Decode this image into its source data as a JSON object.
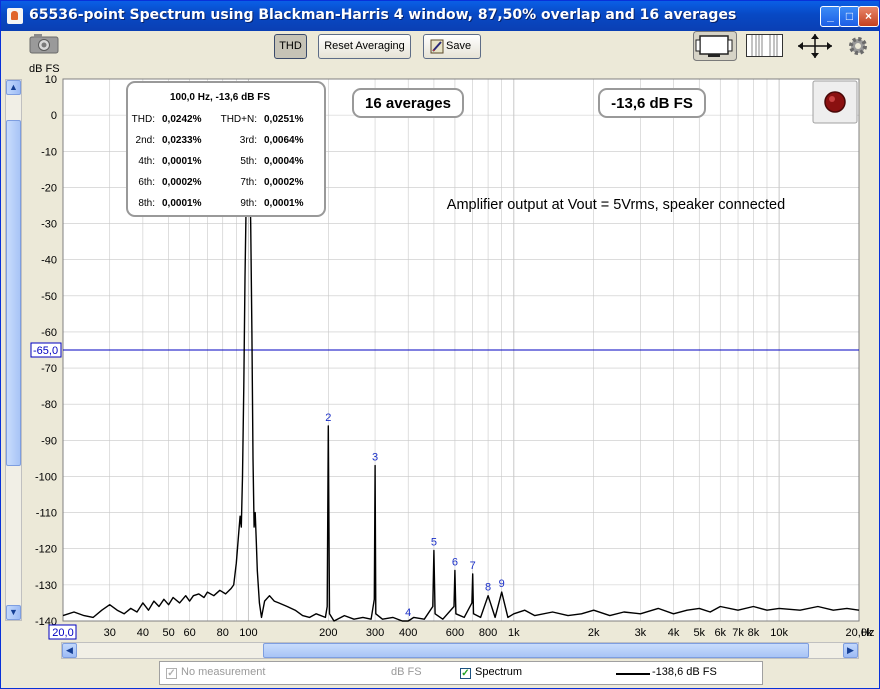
{
  "window": {
    "title": "65536-point Spectrum using Blackman-Harris 4 window, 87,50% overlap and 16 averages",
    "controls": [
      "_",
      "□",
      "×"
    ]
  },
  "toolbar": {
    "thd_label": "THD",
    "reset_label": "Reset Averaging",
    "save_label": "Save",
    "camera_icon": "camera-icon",
    "tool_icons": [
      "monitor-icon",
      "grid-icon",
      "expand-icon",
      "gear-icon"
    ]
  },
  "overlay": {
    "averages_box": "16 averages",
    "level_box": "-13,6 dB FS",
    "annotation": "Amplifier output at Vout = 5Vrms, speaker connected",
    "record_icon": "record-button",
    "thd_header": "100,0 Hz, -13,6 dB FS",
    "thd_rows": [
      {
        "l1": "THD:",
        "v1": "0,0242%",
        "l2": "THD+N:",
        "v2": "0,0251%"
      },
      {
        "l1": "2nd:",
        "v1": "0,0233%",
        "l2": "3rd:",
        "v2": "0,0064%"
      },
      {
        "l1": "4th:",
        "v1": "0,0001%",
        "l2": "5th:",
        "v2": "0,0004%"
      },
      {
        "l1": "6th:",
        "v1": "0,0002%",
        "l2": "7th:",
        "v2": "0,0002%"
      },
      {
        "l1": "8th:",
        "v1": "0,0001%",
        "l2": "9th:",
        "v2": "0,0001%"
      }
    ]
  },
  "legend": {
    "no_measurement": "No measurement",
    "unit": "dB FS",
    "spectrum": "Spectrum",
    "cursor_value": "-138,6 dB FS"
  },
  "colors": {
    "trace": "#000000",
    "cursor_line": "#0000c0",
    "harmonic_label": "#1a2fc8",
    "grid": "#c8c8c8"
  },
  "chart_data": {
    "type": "line",
    "title": "",
    "xlabel": "Hz",
    "ylabel": "dB FS",
    "x_scale": "log",
    "xlim": [
      20,
      20000
    ],
    "ylim": [
      -140,
      10
    ],
    "y_ticks": [
      10,
      0,
      -10,
      -20,
      -30,
      -40,
      -50,
      -60,
      -70,
      -80,
      -90,
      -100,
      -110,
      -120,
      -130,
      -140
    ],
    "x_tick_labels": [
      {
        "v": 20,
        "t": "20,0"
      },
      {
        "v": 30,
        "t": "30"
      },
      {
        "v": 40,
        "t": "40"
      },
      {
        "v": 50,
        "t": "50"
      },
      {
        "v": 60,
        "t": "60"
      },
      {
        "v": 80,
        "t": "80"
      },
      {
        "v": 100,
        "t": "100"
      },
      {
        "v": 200,
        "t": "200"
      },
      {
        "v": 300,
        "t": "300"
      },
      {
        "v": 400,
        "t": "400"
      },
      {
        "v": 600,
        "t": "600"
      },
      {
        "v": 800,
        "t": "800"
      },
      {
        "v": 1000,
        "t": "1k"
      },
      {
        "v": 2000,
        "t": "2k"
      },
      {
        "v": 3000,
        "t": "3k"
      },
      {
        "v": 4000,
        "t": "4k"
      },
      {
        "v": 5000,
        "t": "5k"
      },
      {
        "v": 6000,
        "t": "6k"
      },
      {
        "v": 7000,
        "t": "7k"
      },
      {
        "v": 8000,
        "t": "8k"
      },
      {
        "v": 10000,
        "t": "10k"
      },
      {
        "v": 20000,
        "t": "20,0k"
      }
    ],
    "cursor": {
      "y": -65,
      "label": "-65,0"
    },
    "grid": true,
    "harmonic_labels": [
      {
        "n": "2",
        "x": 200,
        "y": -86
      },
      {
        "n": "3",
        "x": 300,
        "y": -97
      },
      {
        "n": "4",
        "x": 400,
        "y": -140
      },
      {
        "n": "5",
        "x": 500,
        "y": -120.5
      },
      {
        "n": "6",
        "x": 600,
        "y": -126
      },
      {
        "n": "7",
        "x": 700,
        "y": -127
      },
      {
        "n": "8",
        "x": 800,
        "y": -133
      },
      {
        "n": "9",
        "x": 900,
        "y": -132
      }
    ],
    "series": [
      {
        "name": "Spectrum",
        "points": [
          [
            20,
            -138.5
          ],
          [
            22,
            -137.5
          ],
          [
            24,
            -138.5
          ],
          [
            26,
            -139
          ],
          [
            28,
            -137
          ],
          [
            30,
            -135.5
          ],
          [
            32,
            -137
          ],
          [
            34,
            -138
          ],
          [
            36,
            -136.5
          ],
          [
            38,
            -137.5
          ],
          [
            40,
            -135
          ],
          [
            42,
            -137
          ],
          [
            44,
            -134.5
          ],
          [
            46,
            -136
          ],
          [
            48,
            -134
          ],
          [
            50,
            -135.5
          ],
          [
            52,
            -133.5
          ],
          [
            55,
            -135
          ],
          [
            58,
            -133
          ],
          [
            60,
            -134.5
          ],
          [
            62,
            -133
          ],
          [
            65,
            -132.5
          ],
          [
            68,
            -133.5
          ],
          [
            70,
            -132
          ],
          [
            74,
            -133
          ],
          [
            78,
            -131.5
          ],
          [
            82,
            -132.5
          ],
          [
            86,
            -131
          ],
          [
            88,
            -130
          ],
          [
            90,
            -124
          ],
          [
            92,
            -115
          ],
          [
            93,
            -111
          ],
          [
            94,
            -114
          ],
          [
            95,
            -100
          ],
          [
            96,
            -75
          ],
          [
            97,
            -45
          ],
          [
            98,
            -25
          ],
          [
            99,
            -15
          ],
          [
            100,
            -13.6
          ],
          [
            101,
            -15
          ],
          [
            102,
            -30
          ],
          [
            103,
            -60
          ],
          [
            104,
            -95
          ],
          [
            105,
            -114
          ],
          [
            106,
            -110
          ],
          [
            107,
            -118
          ],
          [
            108,
            -126
          ],
          [
            110,
            -135
          ],
          [
            112,
            -139
          ],
          [
            115,
            -134.5
          ],
          [
            120,
            -133
          ],
          [
            125,
            -134.5
          ],
          [
            130,
            -135
          ],
          [
            140,
            -136
          ],
          [
            150,
            -137
          ],
          [
            160,
            -138.5
          ],
          [
            170,
            -139
          ],
          [
            180,
            -138
          ],
          [
            195,
            -139
          ],
          [
            198,
            -136
          ],
          [
            200,
            -86
          ],
          [
            202,
            -138
          ],
          [
            210,
            -140
          ],
          [
            230,
            -138.5
          ],
          [
            250,
            -139.5
          ],
          [
            270,
            -139
          ],
          [
            290,
            -139.5
          ],
          [
            298,
            -134
          ],
          [
            300,
            -97
          ],
          [
            302,
            -138
          ],
          [
            320,
            -139.5
          ],
          [
            350,
            -139
          ],
          [
            380,
            -140
          ],
          [
            400,
            -140
          ],
          [
            420,
            -139
          ],
          [
            460,
            -139.5
          ],
          [
            495,
            -136
          ],
          [
            500,
            -120.5
          ],
          [
            505,
            -138
          ],
          [
            540,
            -139.5
          ],
          [
            595,
            -136
          ],
          [
            600,
            -126
          ],
          [
            605,
            -138
          ],
          [
            650,
            -139
          ],
          [
            695,
            -135
          ],
          [
            700,
            -127
          ],
          [
            705,
            -138
          ],
          [
            750,
            -139
          ],
          [
            800,
            -133
          ],
          [
            850,
            -139
          ],
          [
            900,
            -132
          ],
          [
            950,
            -139
          ],
          [
            1000,
            -138
          ],
          [
            1100,
            -137
          ],
          [
            1200,
            -138.5
          ],
          [
            1400,
            -137.5
          ],
          [
            1600,
            -138.5
          ],
          [
            1800,
            -138
          ],
          [
            2000,
            -137
          ],
          [
            2300,
            -138.5
          ],
          [
            2600,
            -137.5
          ],
          [
            3000,
            -138
          ],
          [
            3500,
            -136.5
          ],
          [
            4000,
            -138
          ],
          [
            4500,
            -137
          ],
          [
            5000,
            -136.5
          ],
          [
            5500,
            -137.5
          ],
          [
            6000,
            -136
          ],
          [
            7000,
            -137
          ],
          [
            8000,
            -136
          ],
          [
            9000,
            -137
          ],
          [
            10000,
            -136.5
          ],
          [
            12000,
            -137
          ],
          [
            14000,
            -136
          ],
          [
            16000,
            -137
          ],
          [
            18000,
            -136.5
          ],
          [
            20000,
            -137
          ]
        ]
      }
    ]
  }
}
